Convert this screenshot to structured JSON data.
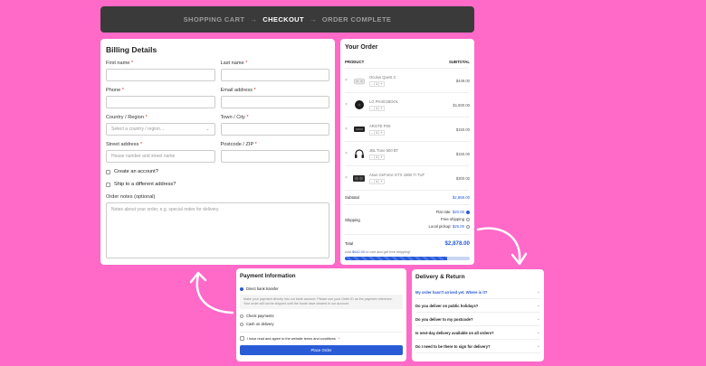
{
  "steps": {
    "cart": "SHOPPING CART",
    "checkout": "CHECKOUT",
    "complete": "ORDER COMPLETE",
    "sep": "→"
  },
  "billing": {
    "title": "Billing Details",
    "first_name": "First name",
    "last_name": "Last name",
    "phone": "Phone",
    "email": "Email address",
    "country": "Country / Region",
    "country_placeholder": "Select a country / region…",
    "town": "Town / City",
    "street": "Street address",
    "street_placeholder": "House number and street name",
    "postcode": "Postcode / ZIP",
    "create_account": "Create an account?",
    "ship_different": "Ship to a different address?",
    "notes": "Order notes (optional)",
    "notes_placeholder": "Notes about your order, e.g. special notes for delivery.",
    "required": "*"
  },
  "order": {
    "title": "Your Order",
    "col_product": "PRODUCT",
    "col_subtotal": "SUBTOTAL",
    "items": [
      {
        "name": "Oculus Quest 3",
        "qty": "1",
        "price": "$449.00",
        "icon": "vr-headset-icon"
      },
      {
        "name": "LG PH4G1BOOL",
        "qty": "1",
        "price": "$1,800.00",
        "icon": "speaker-icon"
      },
      {
        "name": "ARGTE PS5",
        "qty": "1",
        "price": "$150.00",
        "icon": "console-icon"
      },
      {
        "name": "JBL Tune 500 BT",
        "qty": "1",
        "price": "$150.00",
        "icon": "headphones-icon"
      },
      {
        "name": "Asus GeForce GTX 1660 TI TUF",
        "qty": "1",
        "price": "$300.00",
        "icon": "gpu-icon"
      }
    ],
    "remove": "×",
    "minus": "-",
    "plus": "+",
    "subtotal_label": "Subtotal",
    "subtotal_value": "$2,858.00",
    "shipping_label": "Shipping",
    "flat_rate": "Flat rate:",
    "flat_rate_value": "$20.00",
    "free_shipping": "Free shipping",
    "local_pickup": "Local pickup:",
    "local_pickup_value": "$25.00",
    "total_label": "Total",
    "total_value": "$2,878.00",
    "free_msg_pre": "Add",
    "free_msg_amount": "$642.00",
    "free_msg_post": "to cart and get free shipping!",
    "progress": 0.82
  },
  "payment": {
    "title": "Payment Information",
    "bank": "Direct bank transfer",
    "bank_desc": "Make your payment directly into our bank account. Please use your Order ID as the payment reference. Your order will not be shipped until the funds have cleared in our account.",
    "check": "Check payments",
    "cod": "Cash on delivery",
    "terms": "I have read and agree to the website terms and conditions",
    "terms_req": "*",
    "place_order": "Place Order"
  },
  "delivery": {
    "title": "Delivery & Return",
    "faqs": [
      "My order hasn't arrived yet. Where is it?",
      "Do you deliver on public holidays?",
      "Do you deliver to my postcode?",
      "Is next-day delivery available on all orders?",
      "Do I need to be there to sign for delivery?"
    ]
  },
  "colors": {
    "background": "#ff69c8",
    "accent": "#2a5bd7",
    "header": "#3a3a3a"
  }
}
